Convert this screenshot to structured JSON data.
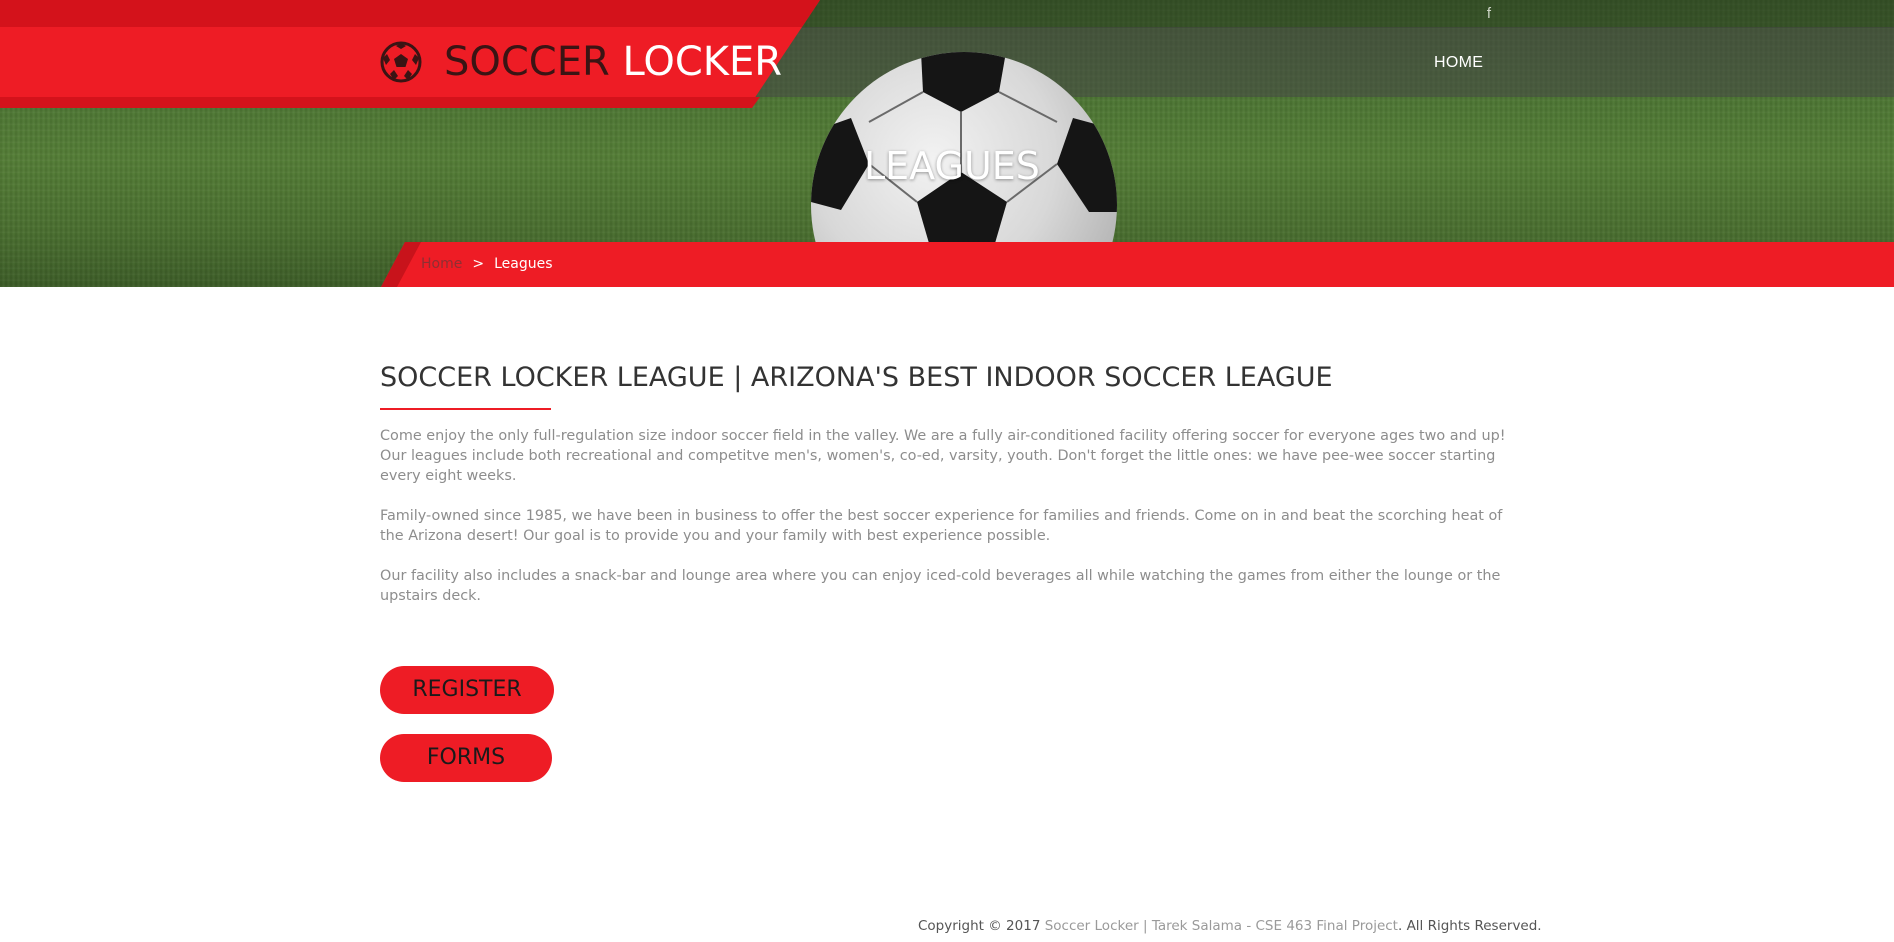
{
  "header": {
    "logo_word1": "SOCCER",
    "logo_word2": "LOCKER",
    "nav_home": "HOME",
    "social_facebook": "f"
  },
  "hero": {
    "title": "LEAGUES"
  },
  "breadcrumb": {
    "home": "Home",
    "separator": ">",
    "current": "Leagues"
  },
  "main": {
    "heading": "SOCCER LOCKER LEAGUE | ARIZONA'S BEST INDOOR SOCCER LEAGUE",
    "paragraphs": [
      "Come enjoy the only full-regulation size indoor soccer field in the valley. We are a fully air-conditioned facility offering soccer for everyone ages two and up! Our leagues include both recreational and competitve men's, women's, co-ed, varsity, youth. Don't forget the little ones: we have pee-wee soccer starting every eight weeks.",
      "Family-owned since 1985, we have been in business to offer the best soccer experience for families and friends. Come on in and beat the scorching heat of the Arizona desert! Our goal is to provide you and your family with best experience possible.",
      "Our facility also includes a snack-bar and lounge area where you can enjoy iced-cold beverages all while watching the games from either the lounge or the upstairs deck."
    ],
    "buttons": {
      "register": "REGISTER",
      "forms": "FORMS"
    }
  },
  "footer": {
    "prefix": "Copyright © 2017 ",
    "link": "Soccer Locker | Tarek Salama - CSE 463 Final Project",
    "suffix": ". All Rights Reserved."
  },
  "colors": {
    "accent_red": "#ee1c25",
    "dark_red": "#d4121b",
    "text_gray": "#8d8d8d",
    "heading_dark": "#333333"
  },
  "icons": {
    "logo": "soccer-ball-icon",
    "social": "facebook-icon"
  }
}
